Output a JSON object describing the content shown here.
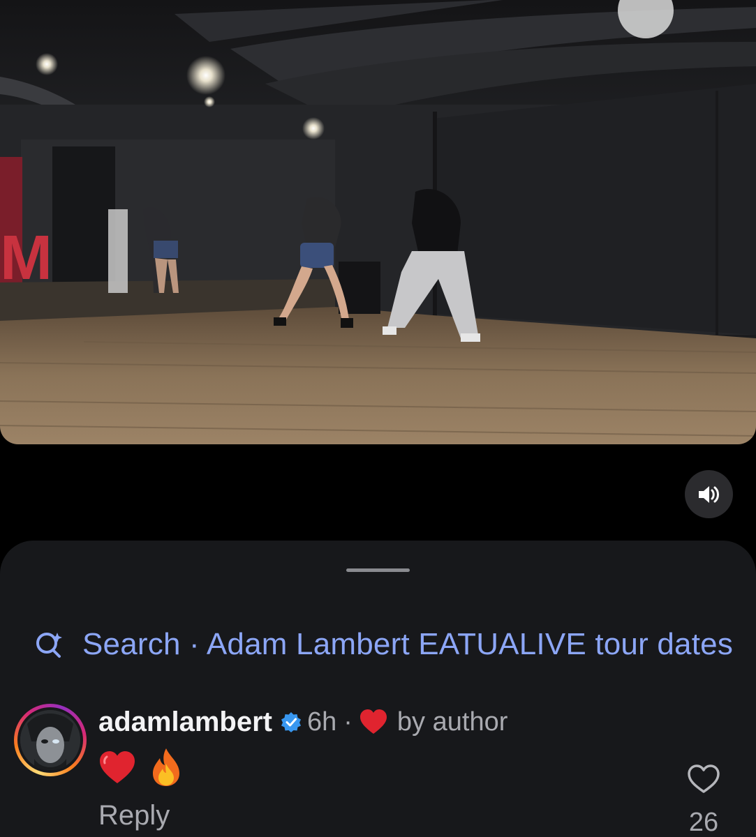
{
  "video": {
    "description_icon": "dance-studio-video-frame",
    "sound_icon": "speaker-on-icon"
  },
  "sheet": {
    "search": {
      "icon": "search-sparkle-icon",
      "label": "Search · Adam Lambert EATUALIVE tour dates"
    },
    "comment": {
      "username": "adamlambert",
      "verified_icon": "verified-badge-icon",
      "time": "6h",
      "separator": "·",
      "by_author_icon": "red-heart-icon",
      "by_author": "by author",
      "emojis": [
        "red-heart-emoji",
        "fire-emoji"
      ],
      "reply_label": "Reply",
      "like_icon": "heart-outline-icon",
      "like_count": "26"
    }
  },
  "colors": {
    "background": "#000000",
    "sheet": "#17181b",
    "link_blue": "#8ca6f6",
    "verified_blue": "#3897f0",
    "heart_red": "#e0242f",
    "muted_text": "#a9aab0"
  }
}
